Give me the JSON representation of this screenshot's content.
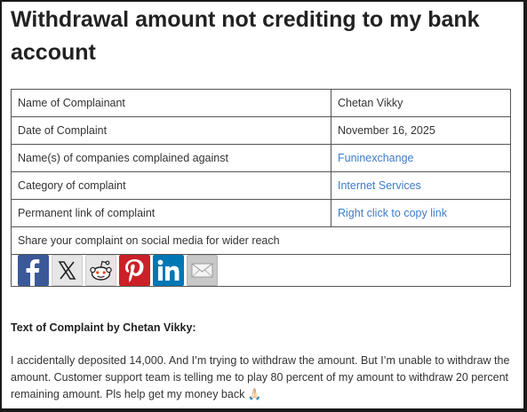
{
  "page": {
    "title": "Withdrawal amount not crediting to my bank account"
  },
  "details": {
    "rows": [
      {
        "label": "Name of Complainant",
        "value": "Chetan Vikky",
        "is_link": false
      },
      {
        "label": "Date of Complaint",
        "value": "November 16, 2025",
        "is_link": false
      },
      {
        "label": "Name(s) of companies complained against",
        "value": "Funinexchange",
        "is_link": true
      },
      {
        "label": "Category of complaint",
        "value": "Internet Services",
        "is_link": true
      },
      {
        "label": "Permanent link of complaint",
        "value": "Right click to copy link",
        "is_link": true
      }
    ],
    "share_text": "Share your complaint on social media for wider reach"
  },
  "share_icons": [
    {
      "icon": "facebook-icon",
      "color": "#3b5998"
    },
    {
      "icon": "x-icon",
      "color": "#e6e6e6"
    },
    {
      "icon": "reddit-icon",
      "color": "#e6e6e6"
    },
    {
      "icon": "pinterest-icon",
      "color": "#cb2027"
    },
    {
      "icon": "linkedin-icon",
      "color": "#0077b5"
    },
    {
      "icon": "email-icon",
      "color": "#c8c8c8"
    }
  ],
  "complaint": {
    "heading": "Text of Complaint by Chetan Vikky:",
    "text": "I accidentally deposited 14,000. And I’m trying to withdraw the amount. But I’m unable to withdraw the amount. Customer support team is telling me to play 80 percent of my amount to withdraw 20 percent remaining amount. Pls help get my money back 🙏🏻"
  },
  "colors": {
    "link": "#3d7cc9",
    "border": "#555555"
  }
}
